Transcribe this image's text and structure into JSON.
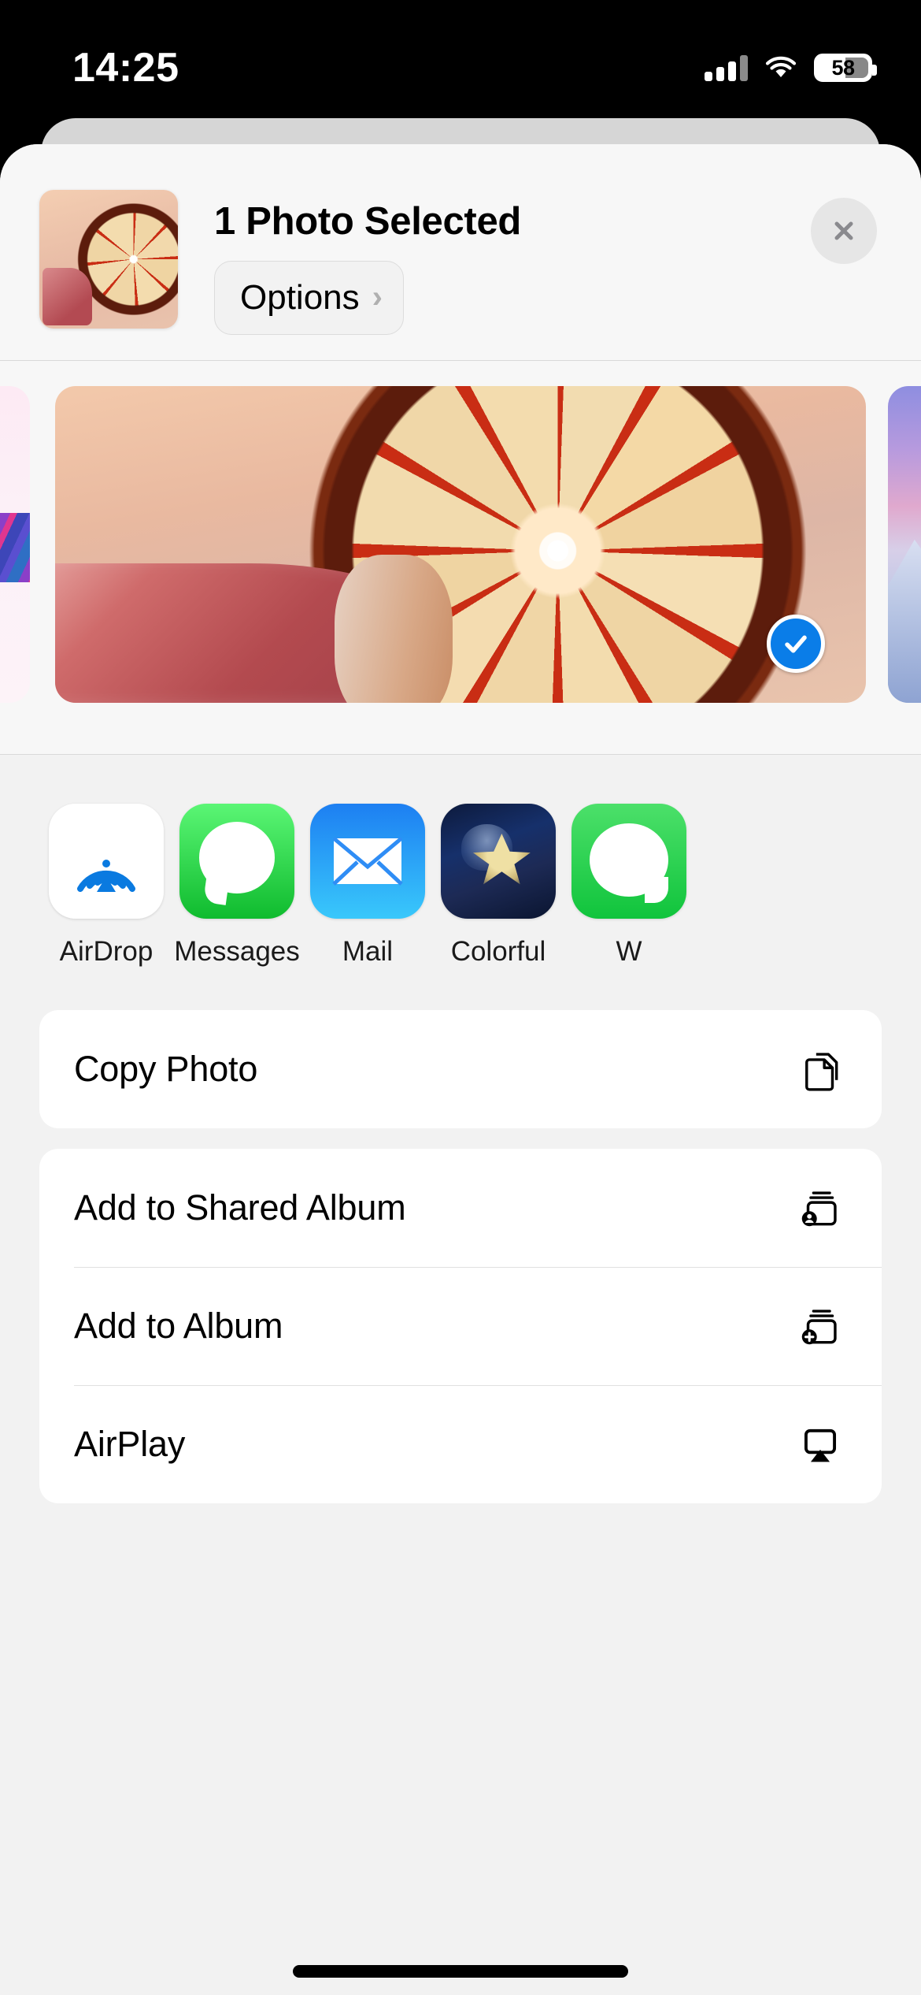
{
  "status_bar": {
    "time": "14:25",
    "battery_percent": "58",
    "signal_icon": "cellular-bars-icon",
    "wifi_icon": "wifi-icon",
    "battery_icon": "battery-icon"
  },
  "header": {
    "title": "1 Photo Selected",
    "options_label": "Options",
    "options_chevron": "›",
    "close_icon": "close-icon",
    "thumbnail_name": "selected-photo-thumbnail"
  },
  "carousel": {
    "prev_photo_name": "previous-photo-partial",
    "main_photo_name": "grapefruit-photo",
    "next_photo_name": "next-photo-partial",
    "selected_check_icon": "checkmark-icon",
    "check_color": "#0a7de8"
  },
  "apps": [
    {
      "label": "AirDrop",
      "icon": "airdrop-icon"
    },
    {
      "label": "Messages",
      "icon": "messages-icon"
    },
    {
      "label": "Mail",
      "icon": "mail-icon"
    },
    {
      "label": "Colorful",
      "icon": "colorful-icon"
    },
    {
      "label": "W",
      "icon": "whatsapp-icon"
    }
  ],
  "action_groups": [
    {
      "rows": [
        {
          "label": "Copy Photo",
          "icon": "copy-icon"
        }
      ]
    },
    {
      "rows": [
        {
          "label": "Add to Shared Album",
          "icon": "shared-album-icon"
        },
        {
          "label": "Add to Album",
          "icon": "add-album-icon"
        },
        {
          "label": "AirPlay",
          "icon": "airplay-icon"
        }
      ]
    }
  ],
  "home_indicator": "home-indicator"
}
